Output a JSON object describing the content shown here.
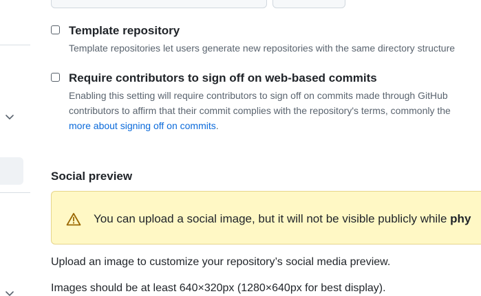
{
  "template_repository": {
    "label": "Template repository",
    "description": "Template repositories let users generate new repositories with the same directory structure"
  },
  "sign_off": {
    "label": "Require contributors to sign off on web-based commits",
    "description_line1": "Enabling this setting will require contributors to sign off on commits made through GitHub",
    "description_line2": "contributors to affirm that their commit complies with the repository's terms, commonly the",
    "link_text": "more about signing off on commits",
    "link_suffix": "."
  },
  "social_preview": {
    "title": "Social preview",
    "warning_text": "You can upload a social image, but it will not be visible publicly while ",
    "warning_bold": "phy",
    "upload_text": "Upload an image to customize your repository’s social media preview.",
    "size_text": "Images should be at least 640×320px (1280×640px for best display)."
  },
  "icons": {
    "warning": "alert-triangle-icon",
    "sidebar_chevron": "chevron-down-icon"
  },
  "colors": {
    "link": "#0969da",
    "warning_bg": "#fff8c5",
    "warning_icon": "#9a6700"
  }
}
